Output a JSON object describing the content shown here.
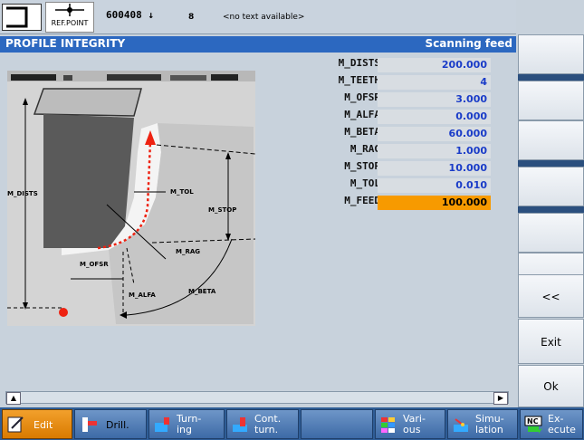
{
  "topbar": {
    "ref_point": "REF.POINT",
    "program": "600408",
    "channel": "8",
    "message": "<no text available>"
  },
  "title": {
    "left": "PROFILE INTEGRITY",
    "right": "Scanning feed"
  },
  "params": [
    {
      "label": "M_DISTS",
      "value": "200.000"
    },
    {
      "label": "M_TEETH",
      "value": "4"
    },
    {
      "label": "M_OFSR",
      "value": "3.000"
    },
    {
      "label": "M_ALFA",
      "value": "0.000"
    },
    {
      "label": "M_BETA",
      "value": "60.000"
    },
    {
      "label": "M_RAG",
      "value": "1.000"
    },
    {
      "label": "M_STOP",
      "value": "10.000"
    },
    {
      "label": "M_TOL",
      "value": "0.010"
    },
    {
      "label": "M_FEED",
      "value": "100.000"
    }
  ],
  "diagram_labels": {
    "dists": "M_DISTS",
    "tol": "M_TOL",
    "stop": "M_STOP",
    "rag": "M_RAG",
    "ofsr": "M_OFSR",
    "alfa": "M_ALFA",
    "beta": "M_BETA"
  },
  "right_softkeys": {
    "back": "<<",
    "exit": "Exit",
    "ok": "Ok"
  },
  "bottom_softkeys": {
    "edit": "Edit",
    "drill": "Drill.",
    "turning_1": "Turn-",
    "turning_2": "ing",
    "cont_1": "Cont.",
    "cont_2": "turn.",
    "various_1": "Vari-",
    "various_2": "ous",
    "sim_1": "Simu-",
    "sim_2": "lation",
    "exec_1": "Ex-",
    "exec_2": "ecute"
  },
  "colors": {
    "title_bar": "#2c68c0",
    "active_field": "#f79a00",
    "value_text": "#1a3cc8"
  }
}
